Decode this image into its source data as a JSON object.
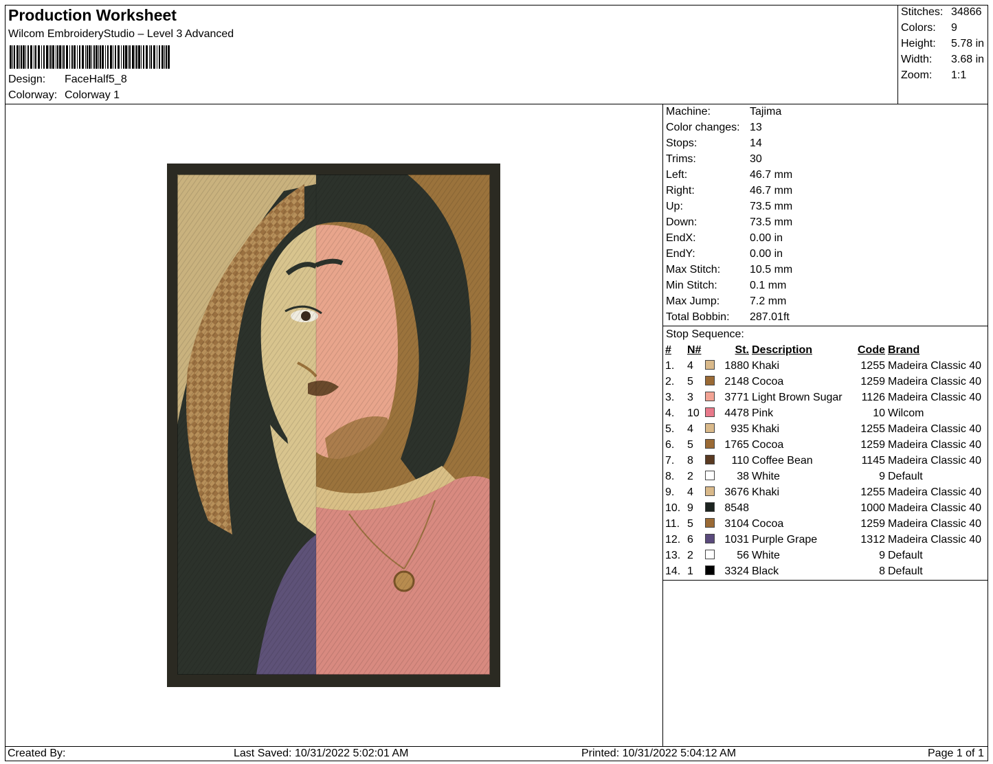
{
  "header": {
    "title": "Production Worksheet",
    "subtitle": "Wilcom EmbroideryStudio – Level 3 Advanced",
    "design_label": "Design:",
    "design_value": "FaceHalf5_8",
    "colorway_label": "Colorway:",
    "colorway_value": "Colorway 1"
  },
  "stats": [
    {
      "label": "Stitches:",
      "value": "34866"
    },
    {
      "label": "Colors:",
      "value": "9"
    },
    {
      "label": "Height:",
      "value": "5.78 in"
    },
    {
      "label": "Width:",
      "value": "3.68 in"
    },
    {
      "label": "Zoom:",
      "value": "1:1"
    }
  ],
  "properties": [
    {
      "label": "Machine:",
      "value": "Tajima"
    },
    {
      "label": "Color changes:",
      "value": "13"
    },
    {
      "label": "Stops:",
      "value": "14"
    },
    {
      "label": "Trims:",
      "value": "30"
    },
    {
      "label": "Left:",
      "value": "46.7 mm"
    },
    {
      "label": "Right:",
      "value": "46.7 mm"
    },
    {
      "label": "Up:",
      "value": "73.5 mm"
    },
    {
      "label": "Down:",
      "value": "73.5 mm"
    },
    {
      "label": "EndX:",
      "value": "0.00 in"
    },
    {
      "label": "EndY:",
      "value": "0.00 in"
    },
    {
      "label": "Max Stitch:",
      "value": "10.5 mm"
    },
    {
      "label": "Min Stitch:",
      "value": "0.1 mm"
    },
    {
      "label": "Max Jump:",
      "value": "7.2 mm"
    },
    {
      "label": "Total Bobbin:",
      "value": "287.01ft"
    }
  ],
  "stop_sequence": {
    "title": "Stop Sequence:",
    "headers": {
      "idx": "#",
      "n": "N#",
      "st": "St.",
      "desc": "Description",
      "code": "Code",
      "brand": "Brand"
    },
    "rows": [
      {
        "idx": "1.",
        "n": "4",
        "color": "#d9b98a",
        "st": "1880",
        "desc": "Khaki",
        "code": "1255",
        "brand": "Madeira Classic 40"
      },
      {
        "idx": "2.",
        "n": "5",
        "color": "#9a6a35",
        "st": "2148",
        "desc": "Cocoa",
        "code": "1259",
        "brand": "Madeira Classic 40"
      },
      {
        "idx": "3.",
        "n": "3",
        "color": "#f2a394",
        "st": "3771",
        "desc": "Light Brown Sugar",
        "code": "1126",
        "brand": "Madeira Classic 40"
      },
      {
        "idx": "4.",
        "n": "10",
        "color": "#e8798a",
        "st": "4478",
        "desc": "Pink",
        "code": "10",
        "brand": "Wilcom"
      },
      {
        "idx": "5.",
        "n": "4",
        "color": "#d9b98a",
        "st": "935",
        "desc": "Khaki",
        "code": "1255",
        "brand": "Madeira Classic 40"
      },
      {
        "idx": "6.",
        "n": "5",
        "color": "#9a6a35",
        "st": "1765",
        "desc": "Cocoa",
        "code": "1259",
        "brand": "Madeira Classic 40"
      },
      {
        "idx": "7.",
        "n": "8",
        "color": "#5a3a22",
        "st": "110",
        "desc": "Coffee Bean",
        "code": "1145",
        "brand": "Madeira Classic 40"
      },
      {
        "idx": "8.",
        "n": "2",
        "color": "#ffffff",
        "st": "38",
        "desc": "White",
        "code": "9",
        "brand": "Default"
      },
      {
        "idx": "9.",
        "n": "4",
        "color": "#d9b98a",
        "st": "3676",
        "desc": "Khaki",
        "code": "1255",
        "brand": "Madeira Classic 40"
      },
      {
        "idx": "10.",
        "n": "9",
        "color": "#1c2420",
        "st": "8548",
        "desc": "",
        "code": "1000",
        "brand": "Madeira Classic 40"
      },
      {
        "idx": "11.",
        "n": "5",
        "color": "#9a6a35",
        "st": "3104",
        "desc": "Cocoa",
        "code": "1259",
        "brand": "Madeira Classic 40"
      },
      {
        "idx": "12.",
        "n": "6",
        "color": "#5a4a7c",
        "st": "1031",
        "desc": "Purple Grape",
        "code": "1312",
        "brand": "Madeira Classic 40"
      },
      {
        "idx": "13.",
        "n": "2",
        "color": "#ffffff",
        "st": "56",
        "desc": "White",
        "code": "9",
        "brand": "Default"
      },
      {
        "idx": "14.",
        "n": "1",
        "color": "#000000",
        "st": "3324",
        "desc": "Black",
        "code": "8",
        "brand": "Default"
      }
    ]
  },
  "footer": {
    "created_by": "Created By:",
    "last_saved": "Last Saved: 10/31/2022 5:02:01 AM",
    "printed": "Printed: 10/31/2022 5:04:12 AM",
    "page": "Page 1 of 1"
  },
  "design_colors": {
    "border": "#2b2a22",
    "khaki_bg": "#c9b27e",
    "cocoa_bg": "#9b733c",
    "skin_left": "#d8c48e",
    "skin_right": "#e8a58c",
    "hair": "#2c322b",
    "shirt_pink": "#d88a80",
    "shirt_purple": "#5e5278",
    "braids": "#9a7040"
  }
}
